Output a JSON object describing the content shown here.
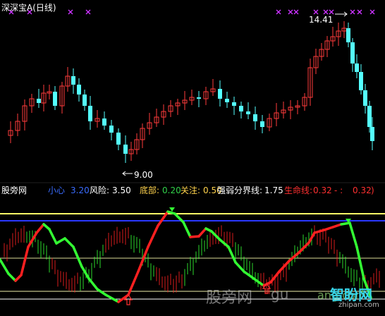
{
  "window": {
    "title": "深深宝A",
    "period": "(日线)"
  },
  "price_labels": {
    "high": "14.41",
    "low": "9.00"
  },
  "indicator": {
    "source": "股旁网",
    "items": [
      {
        "label": "小心",
        "value": "3.20",
        "label_color": "#3a6cff",
        "value_color": "#3a6cff"
      },
      {
        "label": "风险:",
        "value": "3.50",
        "label_color": "#ffffff",
        "value_color": "#ffffff"
      },
      {
        "label": "底部:",
        "value": "0.20",
        "label_color": "#ffd34d",
        "value_color": "#32d24a"
      },
      {
        "label": "关注:",
        "value": "0.50",
        "label_color": "#ffd34d",
        "value_color": "#ffd34d"
      },
      {
        "label": "强弱分界线:",
        "value": "1.75",
        "label_color": "#ffffff",
        "value_color": "#ffffff"
      },
      {
        "label": "生命线:",
        "value": "0.32",
        "label_color": "#ff3030",
        "value_color": "#ff3030"
      },
      {
        "label": "- :",
        "value": "0.32",
        "label_color": "#ff3030",
        "value_color": "#ff3030"
      }
    ],
    "close_mark": ")"
  },
  "watermarks": {
    "left": "股旁网",
    "url_top": "gu",
    "url_right": "ang.com",
    "logo": "智盼网",
    "logo_sub": "zhipan.com"
  },
  "colors": {
    "up": "#ff3b3b",
    "down": "#54ffff",
    "purple_x": "#cc33ff",
    "yellow_line": "#ffff66",
    "blue_line": "#2a38ff",
    "green_curve": "#33ff33",
    "red_curve": "#ff2020"
  },
  "icons": [
    "cross-marker-icon",
    "up-arrow-icon",
    "down-arrow-icon"
  ]
}
